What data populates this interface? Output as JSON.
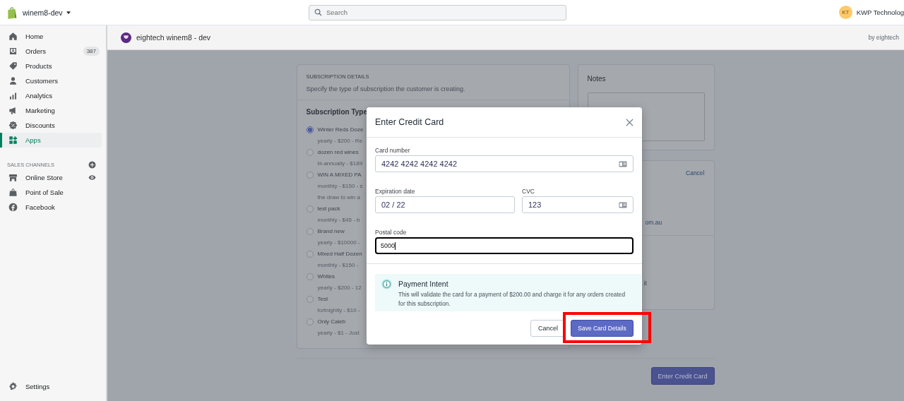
{
  "top_bar": {
    "store_name": "winem8-dev",
    "search": {
      "placeholder": "Search"
    },
    "account": {
      "initials": "KT",
      "name": "KWP Technolog"
    }
  },
  "sidebar": {
    "items": [
      {
        "label": "Home",
        "selected": false
      },
      {
        "label": "Orders",
        "badge": "387",
        "selected": false
      },
      {
        "label": "Products",
        "selected": false
      },
      {
        "label": "Customers",
        "selected": false
      },
      {
        "label": "Analytics",
        "selected": false
      },
      {
        "label": "Marketing",
        "selected": false
      },
      {
        "label": "Discounts",
        "selected": false
      },
      {
        "label": "Apps",
        "selected": true
      }
    ],
    "sales_channels": {
      "heading": "SALES CHANNELS",
      "items": [
        {
          "label": "Online Store"
        },
        {
          "label": "Point of Sale"
        },
        {
          "label": "Facebook"
        }
      ]
    },
    "settings": "Settings"
  },
  "app_header": {
    "title": "eightech winem8 - dev",
    "byline": "by eightech"
  },
  "page": {
    "details_card": {
      "heading": "SUBSCRIPTION DETAILS",
      "description": "Specify the type of subscription the customer is creating.",
      "type_heading": "Subscription Type",
      "options": [
        {
          "label": "Winter Reds Doze",
          "details": [
            "yearly - $200 - Re"
          ],
          "selected": true
        },
        {
          "label": "dozen red wines",
          "details": [
            "bi-annually - $189"
          ],
          "selected": false
        },
        {
          "label": "WIN A MIXED PA",
          "details": [
            "monthly - $150 - s",
            "the draw to win a"
          ],
          "selected": false
        },
        {
          "label": "test pack",
          "details": [
            "monthly - $45 - b"
          ],
          "selected": false
        },
        {
          "label": "Brand new",
          "details": [
            "yearly - $10000 -"
          ],
          "selected": false
        },
        {
          "label": "Mixed Half Dozen",
          "details": [
            "monthly - $150 -"
          ],
          "selected": false
        },
        {
          "label": "Whites",
          "details": [
            "yearly - $200 - 12"
          ],
          "selected": false
        },
        {
          "label": "Test",
          "details": [
            "fortnightly - $10 -"
          ],
          "selected": false
        },
        {
          "label": "Only Caleb",
          "details": [
            "yearly - $1 - Just"
          ],
          "selected": false
        }
      ]
    },
    "notes_card": {
      "title": "Notes"
    },
    "customer_card": {
      "action": "Cancel",
      "texts": [
        "om.au",
        "it"
      ]
    },
    "primary_button": "Enter Credit Card"
  },
  "modal": {
    "title": "Enter Credit Card",
    "card_number": {
      "label": "Card number",
      "value": "4242 4242 4242 4242"
    },
    "expiration": {
      "label": "Expiration date",
      "value": "02 / 22"
    },
    "cvc": {
      "label": "CVC",
      "value": "123"
    },
    "postal": {
      "label": "Postal code",
      "value": "5000",
      "focused": true
    },
    "notice": {
      "title": "Payment Intent",
      "text": "This will validate the card for a payment of $200.00 and charge it for any orders created for this subscription."
    },
    "cancel": "Cancel",
    "save": "Save Card Details",
    "highlight_save": true
  }
}
